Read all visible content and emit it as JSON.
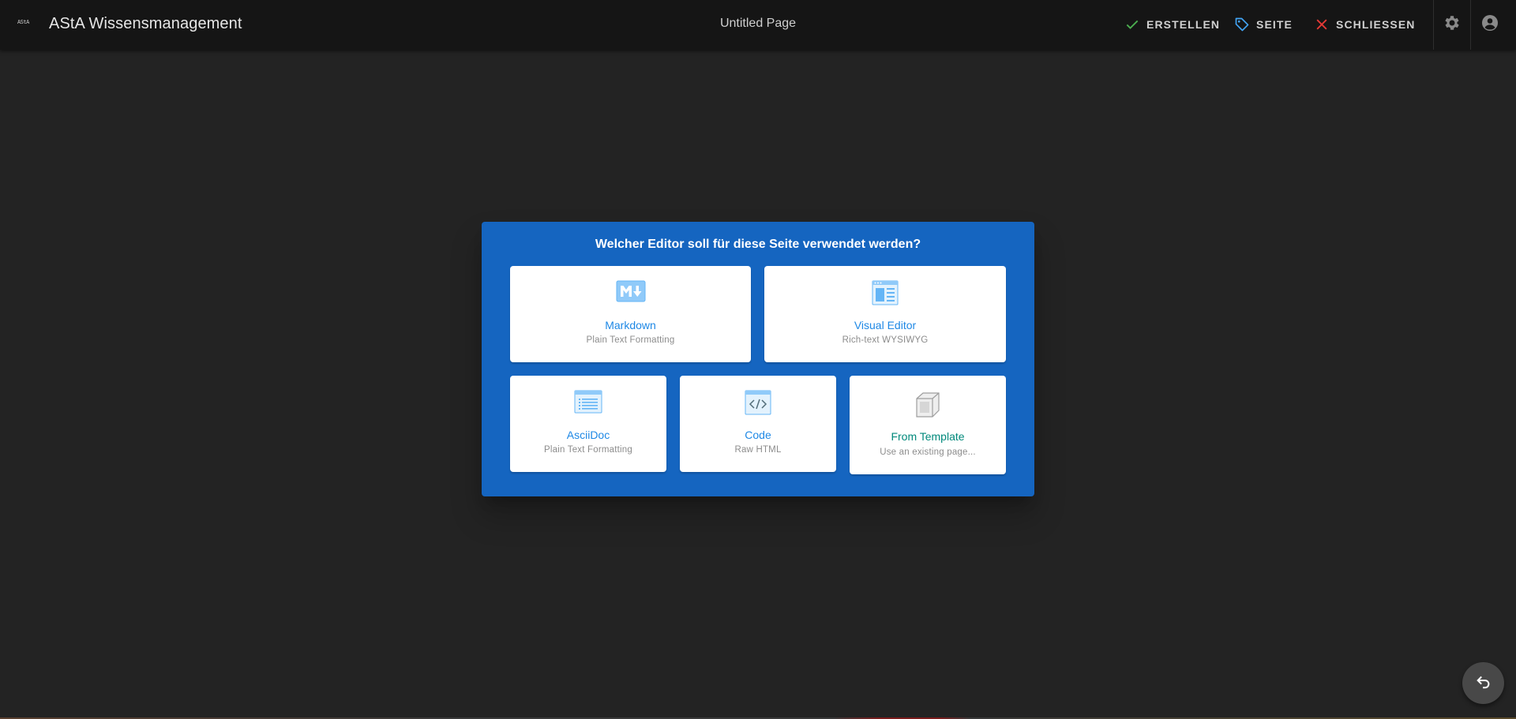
{
  "header": {
    "logo_text": "AStA",
    "app_title": "AStA Wissensmanagement",
    "page_title": "Untitled Page",
    "actions": {
      "create_label": "ERSTELLEN",
      "page_label": "SEITE",
      "close_label": "SCHLIESSEN"
    },
    "icons": {
      "create": "check-icon",
      "page": "tag-icon",
      "close": "close-icon",
      "settings": "gear-icon",
      "account": "account-circle-icon"
    }
  },
  "dialog": {
    "title": "Welcher Editor soll für diese Seite verwendet werden?",
    "editors": [
      {
        "label": "Markdown",
        "subtitle": "Plain Text Formatting",
        "icon": "markdown-icon"
      },
      {
        "label": "Visual Editor",
        "subtitle": "Rich-text WYSIWYG",
        "icon": "visual-editor-icon"
      },
      {
        "label": "AsciiDoc",
        "subtitle": "Plain Text Formatting",
        "icon": "asciidoc-icon"
      },
      {
        "label": "Code",
        "subtitle": "Raw HTML",
        "icon": "code-icon"
      },
      {
        "label": "From Template",
        "subtitle": "Use an existing page...",
        "icon": "template-cube-icon"
      }
    ]
  },
  "fab": {
    "icon": "undo-icon"
  },
  "colors": {
    "background": "#232323",
    "topbar": "#151515",
    "dialog": "#1565c0",
    "card_label": "#1e88e5",
    "card_label_template": "#00897b",
    "create_icon": "#4caf50",
    "page_icon": "#42a5f5",
    "close_icon": "#e53935"
  }
}
